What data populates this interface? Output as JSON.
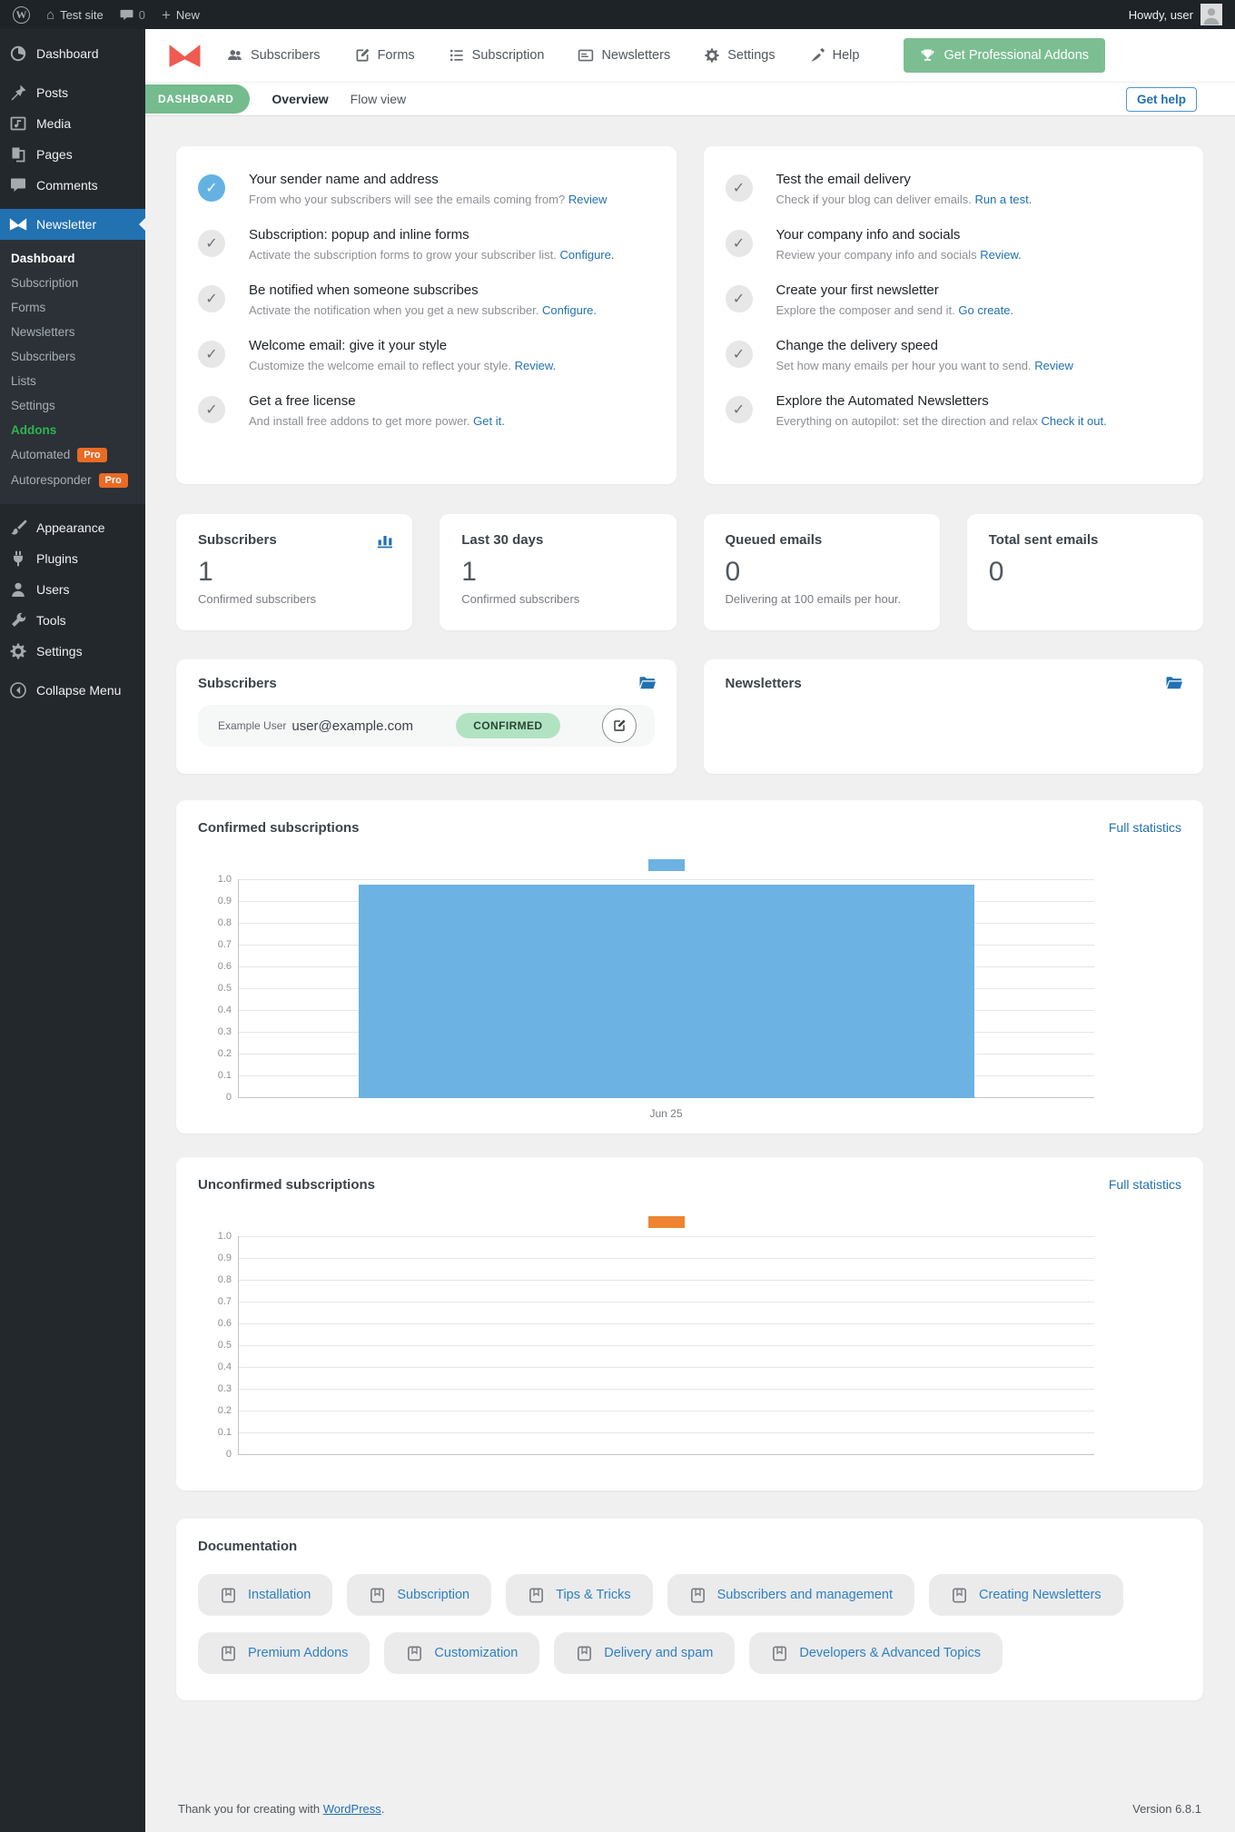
{
  "admin_bar": {
    "site_name": "Test site",
    "comments_count": "0",
    "new_label": "New",
    "howdy": "Howdy, user"
  },
  "sidebar": {
    "pro_badge": "Pro",
    "items_top": [
      {
        "label": "Dashboard",
        "icon": "sym-dashboard"
      },
      {
        "label": "Posts",
        "icon": "sym-pin",
        "gap": true
      },
      {
        "label": "Media",
        "icon": "sym-media"
      },
      {
        "label": "Pages",
        "icon": "sym-pages"
      },
      {
        "label": "Comments",
        "icon": "sym-comments"
      },
      {
        "label": "Newsletter",
        "icon": "sym-nl-logo",
        "active": true,
        "gap": true,
        "red": true
      }
    ],
    "submenu": [
      {
        "label": "Dashboard",
        "current": true
      },
      {
        "label": "Subscription"
      },
      {
        "label": "Forms"
      },
      {
        "label": "Newsletters"
      },
      {
        "label": "Subscribers"
      },
      {
        "label": "Lists"
      },
      {
        "label": "Settings"
      },
      {
        "label": "Addons",
        "highlight": true
      },
      {
        "label": "Automated",
        "pro": true
      },
      {
        "label": "Autoresponder",
        "pro": true
      }
    ],
    "items_bottom": [
      {
        "label": "Appearance",
        "icon": "sym-brush",
        "gap": true
      },
      {
        "label": "Plugins",
        "icon": "sym-plug"
      },
      {
        "label": "Users",
        "icon": "sym-user"
      },
      {
        "label": "Tools",
        "icon": "sym-tools"
      },
      {
        "label": "Settings",
        "icon": "sym-gear"
      },
      {
        "label": "Collapse Menu",
        "icon": "sym-collapse",
        "gap": true
      }
    ]
  },
  "plugin_nav": {
    "items": [
      {
        "label": "Subscribers",
        "icon": "sym-people"
      },
      {
        "label": "Forms",
        "icon": "sym-editsq"
      },
      {
        "label": "Subscription",
        "icon": "sym-listicon"
      },
      {
        "label": "Newsletters",
        "icon": "sym-cardicon"
      },
      {
        "label": "Settings",
        "icon": "sym-gear"
      },
      {
        "label": "Help",
        "icon": "sym-pen"
      }
    ],
    "cta_label": "Get Professional Addons"
  },
  "toolbar": {
    "badge": "DASHBOARD",
    "tabs": [
      {
        "label": "Overview"
      },
      {
        "label": "Flow view"
      }
    ],
    "get_help_label": "Get help"
  },
  "checklists": {
    "left": [
      {
        "done": true,
        "title": "Your sender name and address",
        "desc": "From who your subscribers will see the emails coming from?",
        "link": "Review"
      },
      {
        "done": false,
        "title": "Subscription: popup and inline forms",
        "desc": "Activate the subscription forms to grow your subscriber list.",
        "link": "Configure."
      },
      {
        "done": false,
        "title": "Be notified when someone subscribes",
        "desc": "Activate the notification when you get a new subscriber.",
        "link": "Configure."
      },
      {
        "done": false,
        "title": "Welcome email: give it your style",
        "desc": "Customize the welcome email to reflect your style.",
        "link": "Review."
      },
      {
        "done": false,
        "title": "Get a free license",
        "desc": "And install free addons to get more power.",
        "link": "Get it."
      }
    ],
    "right": [
      {
        "done": false,
        "title": "Test the email delivery",
        "desc": "Check if your blog can deliver emails.",
        "link": "Run a test."
      },
      {
        "done": false,
        "title": "Your company info and socials",
        "desc": "Review your company info and socials",
        "link": "Review."
      },
      {
        "done": false,
        "title": "Create your first newsletter",
        "desc": "Explore the composer and send it.",
        "link": "Go create."
      },
      {
        "done": false,
        "title": "Change the delivery speed",
        "desc": "Set how many emails per hour you want to send.",
        "link": "Review"
      },
      {
        "done": false,
        "title": "Explore the Automated Newsletters",
        "desc": "Everything on autopilot: set the direction and relax",
        "link": "Check it out."
      }
    ]
  },
  "stats": [
    {
      "title": "Subscribers",
      "value": "1",
      "caption": "Confirmed subscribers",
      "icon": "sym-barchart"
    },
    {
      "title": "Last 30 days",
      "value": "1",
      "caption": "Confirmed subscribers"
    },
    {
      "title": "Queued emails",
      "value": "0",
      "caption": "Delivering at 100 emails per hour."
    },
    {
      "title": "Total sent emails",
      "value": "0",
      "caption": ""
    }
  ],
  "subscribers_card": {
    "title": "Subscribers",
    "row": {
      "name": "Example User",
      "email": "user@example.com",
      "status": "CONFIRMED"
    }
  },
  "newsletters_card": {
    "title": "Newsletters"
  },
  "chart_data": [
    {
      "type": "bar",
      "title": "Confirmed subscriptions",
      "link": "Full statistics",
      "x": [
        "Jun 25"
      ],
      "values": [
        1
      ],
      "ylim": [
        0,
        1
      ],
      "yticks": [
        "1.0",
        "0.9",
        "0.8",
        "0.7",
        "0.6",
        "0.5",
        "0.4",
        "0.3",
        "0.2",
        "0.1",
        "0"
      ],
      "color": "#6cb2e2",
      "grid": true,
      "legend_position": "top"
    },
    {
      "type": "bar",
      "title": "Unconfirmed subscriptions",
      "link": "Full statistics",
      "x": [],
      "values": [],
      "ylim": [
        0,
        1
      ],
      "yticks": [
        "1.0",
        "0.9",
        "0.8",
        "0.7",
        "0.6",
        "0.5",
        "0.4",
        "0.3",
        "0.2",
        "0.1",
        "0"
      ],
      "color": "#ee8432",
      "grid": true,
      "legend_position": "top"
    }
  ],
  "documentation": {
    "title": "Documentation",
    "buttons": [
      "Installation",
      "Subscription",
      "Tips & Tricks",
      "Subscribers and management",
      "Creating Newsletters",
      "Premium Addons",
      "Customization",
      "Delivery and spam",
      "Developers & Advanced Topics"
    ]
  },
  "footer": {
    "thanks": "Thank you for creating with",
    "wordpress": "WordPress",
    "period": ".",
    "version": "Version 6.8.1"
  }
}
